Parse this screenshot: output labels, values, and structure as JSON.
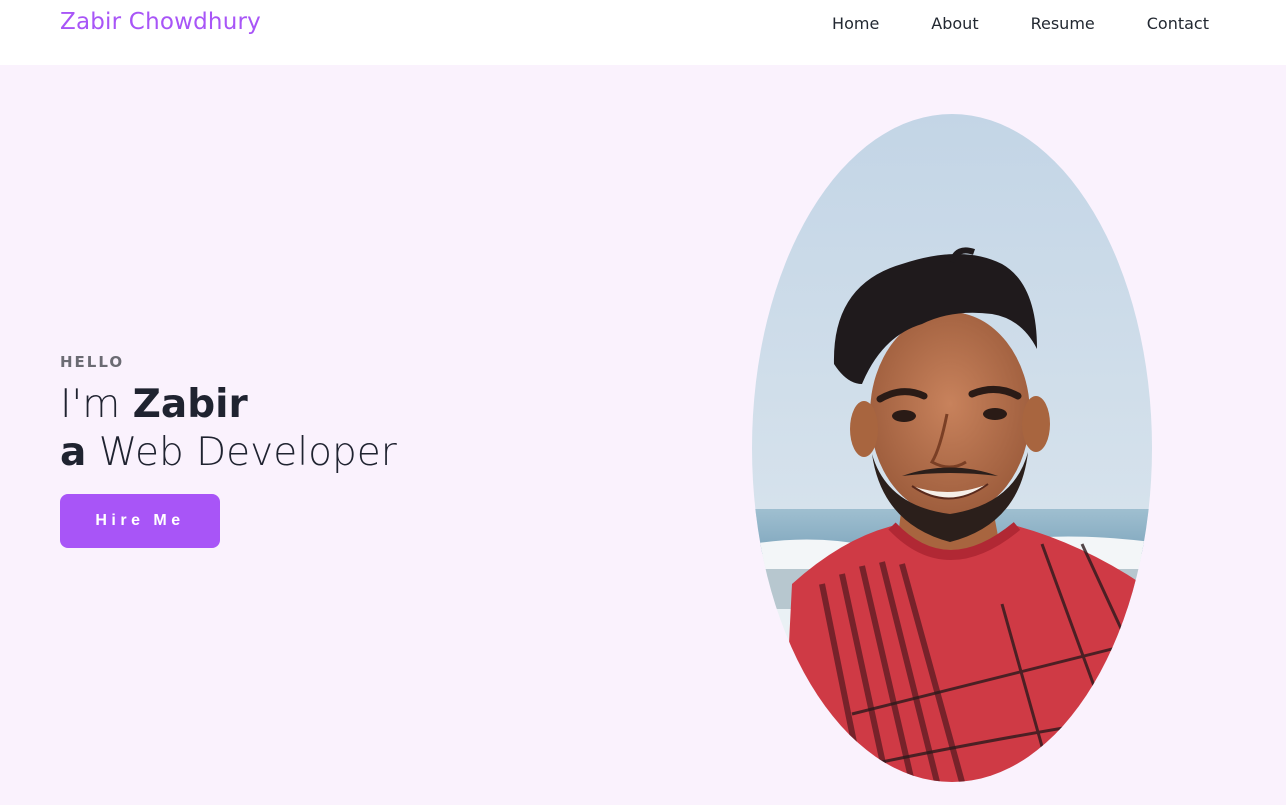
{
  "nav": {
    "brand": "Zabir Chowdhury",
    "links": [
      {
        "label": "Home"
      },
      {
        "label": "About"
      },
      {
        "label": "Resume"
      },
      {
        "label": "Contact"
      }
    ]
  },
  "hero": {
    "greeting": "HELLO",
    "line1_prefix": "I'm ",
    "name": "Zabir",
    "line2_bold": "a",
    "role": " Web Developer",
    "cta_label": "Hire Me"
  },
  "colors": {
    "accent": "#a855f7",
    "page_background": "#faf2fd",
    "navbar_background": "#ffffff",
    "text_dark": "#1f2330"
  }
}
